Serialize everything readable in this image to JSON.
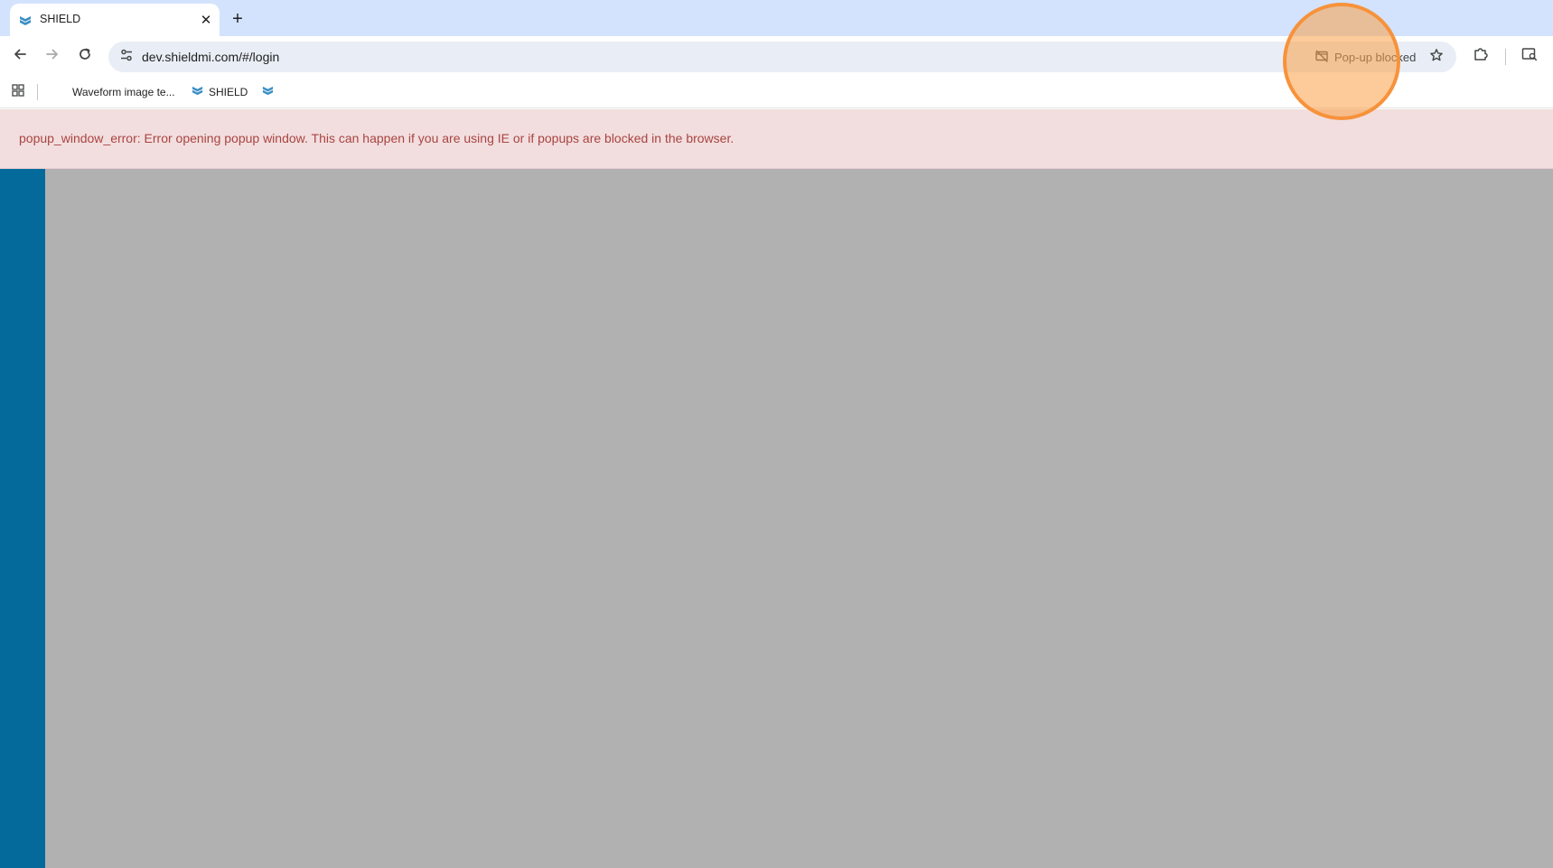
{
  "browser": {
    "tab": {
      "title": "SHIELD",
      "favicon": "shield-chevron-icon",
      "close_glyph": "✕"
    },
    "new_tab_glyph": "+",
    "toolbar": {
      "back_icon": "arrow-left-icon",
      "forward_icon": "arrow-right-icon",
      "reload_icon": "reload-icon",
      "site_info_icon": "tune-icon",
      "url": "dev.shieldmi.com/#/login",
      "popup_blocked_label": "Pop-up blocked",
      "star_icon": "star-icon",
      "extensions_icon": "puzzle-icon",
      "lens_icon": "search-panel-icon"
    },
    "bookmarks": [
      {
        "label": "Waveform image te...",
        "icon": "none"
      },
      {
        "label": "SHIELD",
        "icon": "shield-chevron-icon"
      },
      {
        "label": "",
        "icon": "shield-chevron-icon"
      }
    ]
  },
  "page": {
    "error_message": "popup_window_error: Error opening popup window. This can happen if you are using IE or if popups are blocked in the browser."
  },
  "colors": {
    "tabstrip_bg": "#d3e3fd",
    "omnibox_bg": "#e9eef6",
    "error_bg": "#f2dede",
    "error_text": "#a94442",
    "sidebar": "#046a9b",
    "overlay": "#b1b1b1",
    "highlight": "#f7923b",
    "shield_icon": "#3b8fc4"
  }
}
